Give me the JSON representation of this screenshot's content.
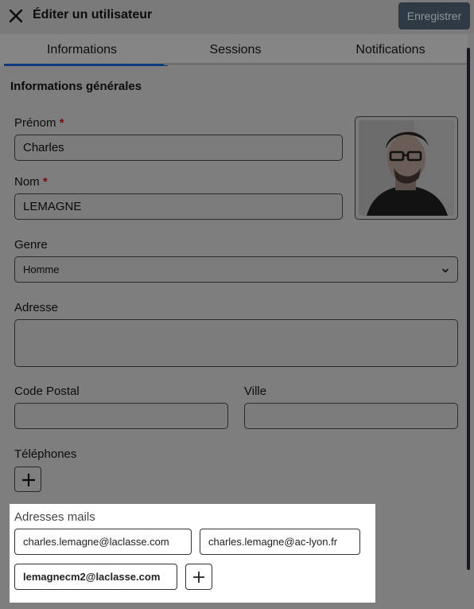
{
  "header": {
    "title": "Éditer un utilisateur",
    "save_label": "Enregistrer"
  },
  "tabs": [
    {
      "label": "Informations",
      "active": true
    },
    {
      "label": "Sessions",
      "active": false
    },
    {
      "label": "Notifications",
      "active": false
    }
  ],
  "section_title": "Informations générales",
  "form": {
    "firstname_label": "Prénom",
    "firstname_value": "Charles",
    "lastname_label": "Nom",
    "lastname_value": "LEMAGNE",
    "required_mark": "*",
    "gender_label": "Genre",
    "gender_value": "Homme",
    "address_label": "Adresse",
    "address_value": "",
    "postal_label": "Code Postal",
    "postal_value": "",
    "city_label": "Ville",
    "city_value": "",
    "phones_label": "Téléphones"
  },
  "emails": {
    "title": "Adresses mails",
    "items": [
      {
        "address": "charles.lemagne@laclasse.com",
        "primary": false
      },
      {
        "address": "charles.lemagne@ac-lyon.fr",
        "primary": false
      },
      {
        "address": "lemagnecm2@laclasse.com",
        "primary": true
      }
    ]
  },
  "icons": {
    "close": "close-icon",
    "add": "plus-icon",
    "dropdown": "chevron-down-icon",
    "avatar": "user-photo"
  },
  "colors": {
    "accent": "#0e3b7a",
    "required": "#7a0b0b",
    "overlay": "#7e7e7e"
  }
}
